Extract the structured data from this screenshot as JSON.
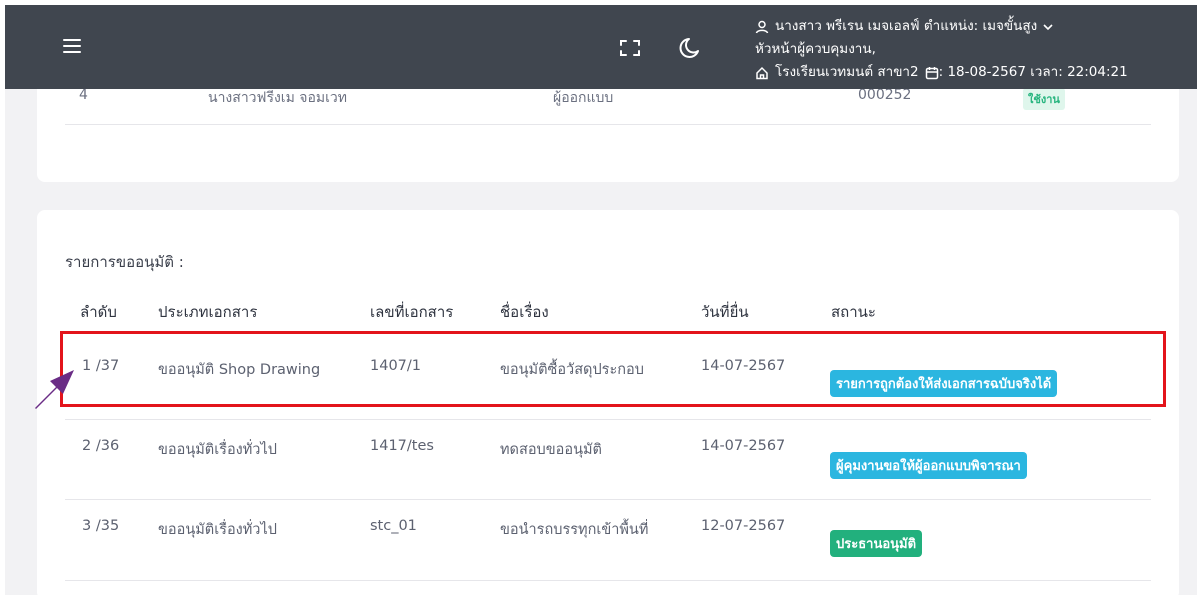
{
  "header": {
    "user_line": "นางสาว พรีเรน เมจเอลฟ์ ตำแหน่ง: เมจขั้นสูง",
    "role_line": "หัวหน้าผู้ควบคุมงาน,",
    "school_line": "โรงเรียนเวทมนต์ สาขา2",
    "datetime_line": ": 18-08-2567 เวลา: 22:04:21",
    "icons": [
      "menu-icon",
      "fullscreen-icon",
      "moon-icon",
      "user-icon",
      "chevron-down-icon",
      "home-icon",
      "calendar-icon"
    ]
  },
  "top_table": {
    "row": {
      "index": "4",
      "name": "นางสาวฟรีงเม จอมเวท",
      "role": "ผู้ออกแบบ",
      "code": "000252",
      "status": "ใช้งาน"
    }
  },
  "approval": {
    "section_label": "รายการขออนุมัติ :",
    "columns": [
      "ลำดับ",
      "ประเภทเอกสาร",
      "เลขที่เอกสาร",
      "ชื่อเรื่อง",
      "วันที่ยื่น",
      "สถานะ"
    ],
    "rows": [
      {
        "seq": "1 /37",
        "doc_type": "ขออนุมัติ Shop Drawing",
        "doc_no": "1407/1",
        "subject": "ขอนุมัติซื้อวัสดุประกอบ",
        "date": "14-07-2567",
        "status": "รายการถูกต้องให้ส่งเอกสารฉบับจริงได้",
        "status_color": "#2bb6e0"
      },
      {
        "seq": "2 /36",
        "doc_type": "ขออนุมัติเรื่องทั่วไป",
        "doc_no": "1417/tes",
        "subject": "ทดสอบขออนุมัติ",
        "date": "14-07-2567",
        "status": "ผู้คุมงานขอให้ผู้ออกแบบพิจารณา",
        "status_color": "#2bb6e0"
      },
      {
        "seq": "3 /35",
        "doc_type": "ขออนุมัติเรื่องทั่วไป",
        "doc_no": "stc_01",
        "subject": "ขอนำรถบรรทุกเข้าพื้นที่",
        "date": "12-07-2567",
        "status": "ประธานอนุมัติ",
        "status_color": "#22b07d"
      }
    ]
  },
  "annotation": {
    "highlight_color": "#e3141b",
    "arrow_color": "#6a2c85"
  }
}
